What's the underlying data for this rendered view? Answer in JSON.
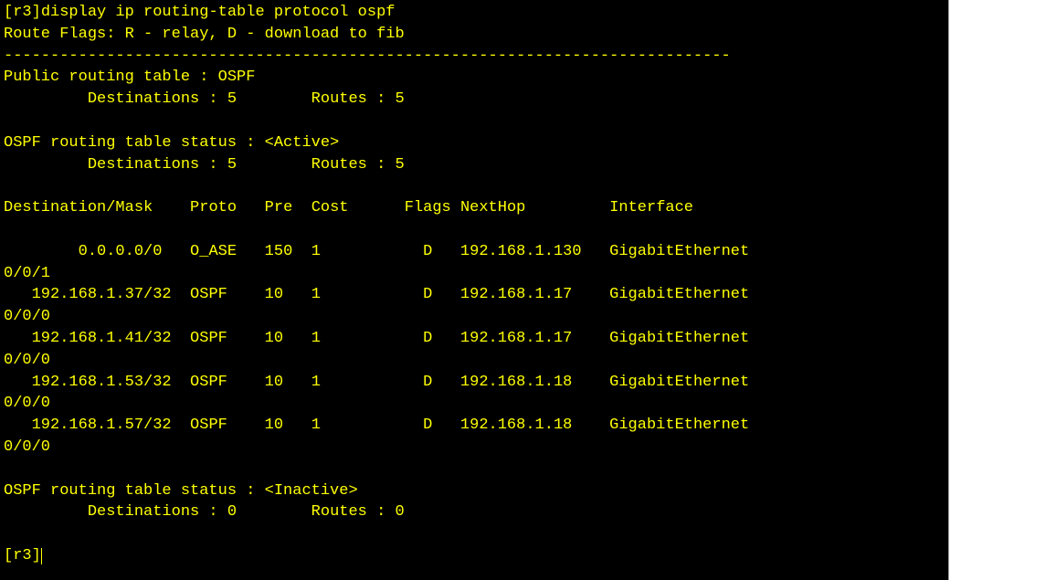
{
  "prompt": "[r3]",
  "command": "display ip routing-table protocol ospf",
  "flags_header": "Route Flags: R - relay, D - download to fib",
  "divider": "------------------------------------------------------------------------------",
  "public_table_title": "Public routing table : OSPF",
  "public_dest_label": "         Destinations : 5",
  "public_routes_label": "Routes : 5",
  "active_status_title": "OSPF routing table status : <Active>",
  "active_dest_label": "         Destinations : 5",
  "active_routes_label": "Routes : 5",
  "headers": {
    "dest": "Destination/Mask",
    "proto": "Proto",
    "pre": "Pre",
    "cost": "Cost",
    "flags": "Flags",
    "nexthop": "NextHop",
    "interface": "Interface"
  },
  "routes": [
    {
      "dest": "        0.0.0.0/0",
      "proto": "O_ASE",
      "pre": "150",
      "cost": "1",
      "flags": "D",
      "nexthop": "192.168.1.130",
      "interface": "GigabitEthernet",
      "wrap": "0/0/1"
    },
    {
      "dest": "   192.168.1.37/32",
      "proto": "OSPF",
      "pre": "10",
      "cost": "1",
      "flags": "D",
      "nexthop": "192.168.1.17",
      "interface": "GigabitEthernet",
      "wrap": "0/0/0"
    },
    {
      "dest": "   192.168.1.41/32",
      "proto": "OSPF",
      "pre": "10",
      "cost": "1",
      "flags": "D",
      "nexthop": "192.168.1.17",
      "interface": "GigabitEthernet",
      "wrap": "0/0/0"
    },
    {
      "dest": "   192.168.1.53/32",
      "proto": "OSPF",
      "pre": "10",
      "cost": "1",
      "flags": "D",
      "nexthop": "192.168.1.18",
      "interface": "GigabitEthernet",
      "wrap": "0/0/0"
    },
    {
      "dest": "   192.168.1.57/32",
      "proto": "OSPF",
      "pre": "10",
      "cost": "1",
      "flags": "D",
      "nexthop": "192.168.1.18",
      "interface": "GigabitEthernet",
      "wrap": "0/0/0"
    }
  ],
  "inactive_status_title": "OSPF routing table status : <Inactive>",
  "inactive_dest_label": "         Destinations : 0",
  "inactive_routes_label": "Routes : 0",
  "end_prompt": "[r3]"
}
